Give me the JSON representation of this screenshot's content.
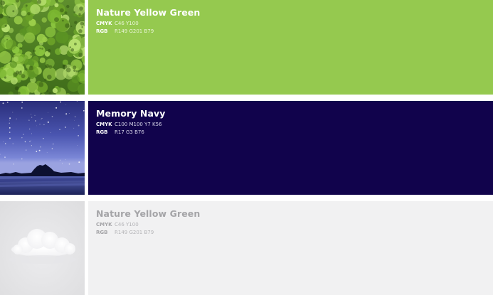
{
  "palette": [
    {
      "name": "Nature Yellow Green",
      "photo": "forest-canopy-photo",
      "color": "#95c94f",
      "cmyk_label": "CMYK",
      "cmyk_value": "C46 Y100",
      "rgb_label": "RGB",
      "rgb_value": "R149 G201 B79"
    },
    {
      "name": "Memory Navy",
      "photo": "night-sky-lake-photo",
      "color": "#11034c",
      "cmyk_label": "CMYK",
      "cmyk_value": "C100 M100 Y7 K56",
      "rgb_label": "RGB",
      "rgb_value": "R17 G3 B76"
    },
    {
      "name": "Nature Yellow Green",
      "photo": "cloud-photo",
      "color": "#f1f1f2",
      "cmyk_label": "CMYK",
      "cmyk_value": "C46 Y100",
      "rgb_label": "RGB",
      "rgb_value": "R149 G201 B79"
    }
  ]
}
